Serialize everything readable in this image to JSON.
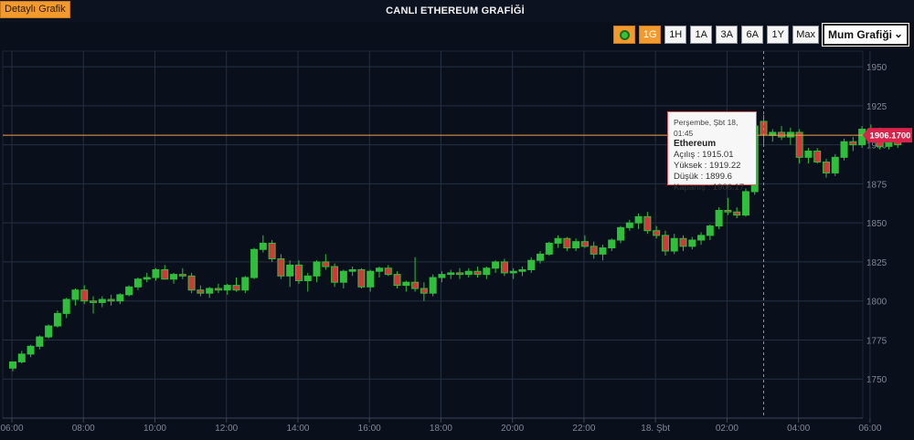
{
  "header": {
    "detail_button": "Detaylı Grafik",
    "title": "CANLI ETHEREUM GRAFİĞİ"
  },
  "controls": {
    "live_color": "#38c23a",
    "ranges": [
      "1G",
      "1H",
      "1A",
      "3A",
      "6A",
      "1Y",
      "Max"
    ],
    "active_range": "1G",
    "chart_type_selected": "Mum Grafiği"
  },
  "tooltip": {
    "date": "Perşembe, Şbt 18, 01:45",
    "name": "Ethereum",
    "open": "Açılış : 1915.01",
    "high": "Yüksek : 1919.22",
    "low": "Düşük : 1899.6",
    "close": "Kapanış : 1906.17"
  },
  "colors": {
    "background": "#0a0f1c",
    "up": "#2fbf3a",
    "down": "#d23a3a",
    "last_price_line": "#f0a04a",
    "last_price_label": "#d8234a",
    "grid": "#253041"
  },
  "chart_data": {
    "type": "candlestick",
    "title": "CANLI ETHEREUM GRAFİĞİ",
    "ylim": [
      1725,
      1960
    ],
    "y_ticks": [
      1750,
      1775,
      1800,
      1825,
      1850,
      1875,
      1900,
      1925,
      1950
    ],
    "y_tick_labels": [
      "1750",
      "1775",
      "1800",
      "1825",
      "1850",
      "1875",
      "1900",
      "1925",
      "1950"
    ],
    "x_tick_labels": [
      "06:00",
      "08:00",
      "10:00",
      "12:00",
      "14:00",
      "16:00",
      "18:00",
      "20:00",
      "22:00",
      "18. Şbt",
      "02:00",
      "04:00",
      "06:00"
    ],
    "interval_minutes": 15,
    "last_price": 1906.17,
    "last_price_label": "1906.1700",
    "candles": [
      [
        1757,
        1761,
        1755,
        1761
      ],
      [
        1761,
        1768,
        1760,
        1766
      ],
      [
        1766,
        1772,
        1764,
        1771
      ],
      [
        1771,
        1778,
        1769,
        1777
      ],
      [
        1777,
        1785,
        1776,
        1784
      ],
      [
        1784,
        1794,
        1783,
        1792
      ],
      [
        1792,
        1802,
        1789,
        1801
      ],
      [
        1801,
        1808,
        1797,
        1807
      ],
      [
        1807,
        1810,
        1798,
        1800
      ],
      [
        1800,
        1803,
        1792,
        1799
      ],
      [
        1799,
        1803,
        1796,
        1801
      ],
      [
        1801,
        1804,
        1797,
        1800
      ],
      [
        1800,
        1805,
        1798,
        1804
      ],
      [
        1804,
        1810,
        1803,
        1809
      ],
      [
        1809,
        1815,
        1807,
        1814
      ],
      [
        1814,
        1818,
        1812,
        1815
      ],
      [
        1815,
        1821,
        1813,
        1820
      ],
      [
        1820,
        1823,
        1815,
        1814
      ],
      [
        1814,
        1818,
        1811,
        1817
      ],
      [
        1817,
        1821,
        1814,
        1816
      ],
      [
        1816,
        1818,
        1805,
        1807
      ],
      [
        1807,
        1810,
        1803,
        1805
      ],
      [
        1805,
        1809,
        1802,
        1808
      ],
      [
        1808,
        1811,
        1805,
        1807
      ],
      [
        1807,
        1811,
        1804,
        1810
      ],
      [
        1810,
        1815,
        1806,
        1807
      ],
      [
        1807,
        1816,
        1805,
        1815
      ],
      [
        1815,
        1834,
        1814,
        1833
      ],
      [
        1833,
        1842,
        1831,
        1837
      ],
      [
        1837,
        1839,
        1825,
        1827
      ],
      [
        1827,
        1830,
        1814,
        1816
      ],
      [
        1816,
        1826,
        1809,
        1823
      ],
      [
        1823,
        1826,
        1811,
        1813
      ],
      [
        1813,
        1818,
        1806,
        1816
      ],
      [
        1816,
        1826,
        1812,
        1825
      ],
      [
        1825,
        1830,
        1820,
        1822
      ],
      [
        1822,
        1824,
        1809,
        1812
      ],
      [
        1812,
        1820,
        1808,
        1819
      ],
      [
        1819,
        1822,
        1816,
        1820
      ],
      [
        1820,
        1821,
        1808,
        1809
      ],
      [
        1809,
        1820,
        1806,
        1819
      ],
      [
        1819,
        1822,
        1815,
        1821
      ],
      [
        1821,
        1823,
        1816,
        1817
      ],
      [
        1817,
        1819,
        1808,
        1810
      ],
      [
        1810,
        1813,
        1806,
        1812
      ],
      [
        1812,
        1828,
        1806,
        1808
      ],
      [
        1808,
        1812,
        1800,
        1805
      ],
      [
        1805,
        1817,
        1803,
        1815
      ],
      [
        1815,
        1819,
        1812,
        1817
      ],
      [
        1817,
        1820,
        1814,
        1818
      ],
      [
        1818,
        1821,
        1814,
        1817
      ],
      [
        1817,
        1821,
        1815,
        1819
      ],
      [
        1819,
        1822,
        1815,
        1817
      ],
      [
        1817,
        1822,
        1814,
        1821
      ],
      [
        1821,
        1826,
        1818,
        1825
      ],
      [
        1825,
        1827,
        1816,
        1818
      ],
      [
        1818,
        1821,
        1814,
        1819
      ],
      [
        1819,
        1822,
        1816,
        1820
      ],
      [
        1820,
        1828,
        1818,
        1826
      ],
      [
        1826,
        1832,
        1824,
        1830
      ],
      [
        1830,
        1838,
        1829,
        1837
      ],
      [
        1837,
        1842,
        1834,
        1840
      ],
      [
        1840,
        1841,
        1832,
        1834
      ],
      [
        1834,
        1840,
        1832,
        1838
      ],
      [
        1838,
        1842,
        1834,
        1835
      ],
      [
        1835,
        1838,
        1827,
        1830
      ],
      [
        1830,
        1836,
        1826,
        1834
      ],
      [
        1834,
        1840,
        1832,
        1839
      ],
      [
        1839,
        1848,
        1837,
        1847
      ],
      [
        1847,
        1852,
        1845,
        1850
      ],
      [
        1850,
        1856,
        1846,
        1854
      ],
      [
        1854,
        1857,
        1843,
        1845
      ],
      [
        1845,
        1848,
        1840,
        1842
      ],
      [
        1842,
        1845,
        1829,
        1832
      ],
      [
        1832,
        1843,
        1830,
        1840
      ],
      [
        1840,
        1842,
        1832,
        1835
      ],
      [
        1835,
        1841,
        1833,
        1839
      ],
      [
        1839,
        1844,
        1836,
        1842
      ],
      [
        1842,
        1849,
        1839,
        1848
      ],
      [
        1848,
        1860,
        1846,
        1858
      ],
      [
        1858,
        1866,
        1855,
        1857
      ],
      [
        1857,
        1860,
        1853,
        1855
      ],
      [
        1855,
        1872,
        1854,
        1870
      ],
      [
        1870,
        1915,
        1868,
        1912
      ],
      [
        1915.01,
        1919.22,
        1899.6,
        1906.17
      ],
      [
        1906,
        1910,
        1902,
        1908
      ],
      [
        1908,
        1912,
        1903,
        1905
      ],
      [
        1905,
        1911,
        1900,
        1908
      ],
      [
        1908,
        1910,
        1888,
        1892
      ],
      [
        1892,
        1898,
        1888,
        1896
      ],
      [
        1896,
        1898,
        1888,
        1889
      ],
      [
        1889,
        1891,
        1879,
        1882
      ],
      [
        1882,
        1894,
        1880,
        1892
      ],
      [
        1892,
        1904,
        1890,
        1902
      ],
      [
        1902,
        1905,
        1896,
        1900
      ],
      [
        1900,
        1912,
        1898,
        1910
      ],
      [
        1910,
        1913,
        1906,
        1909
      ],
      [
        1909,
        1911,
        1897,
        1899
      ],
      [
        1899,
        1904,
        1897,
        1902
      ],
      [
        1902,
        1903,
        1898,
        1900
      ]
    ]
  }
}
